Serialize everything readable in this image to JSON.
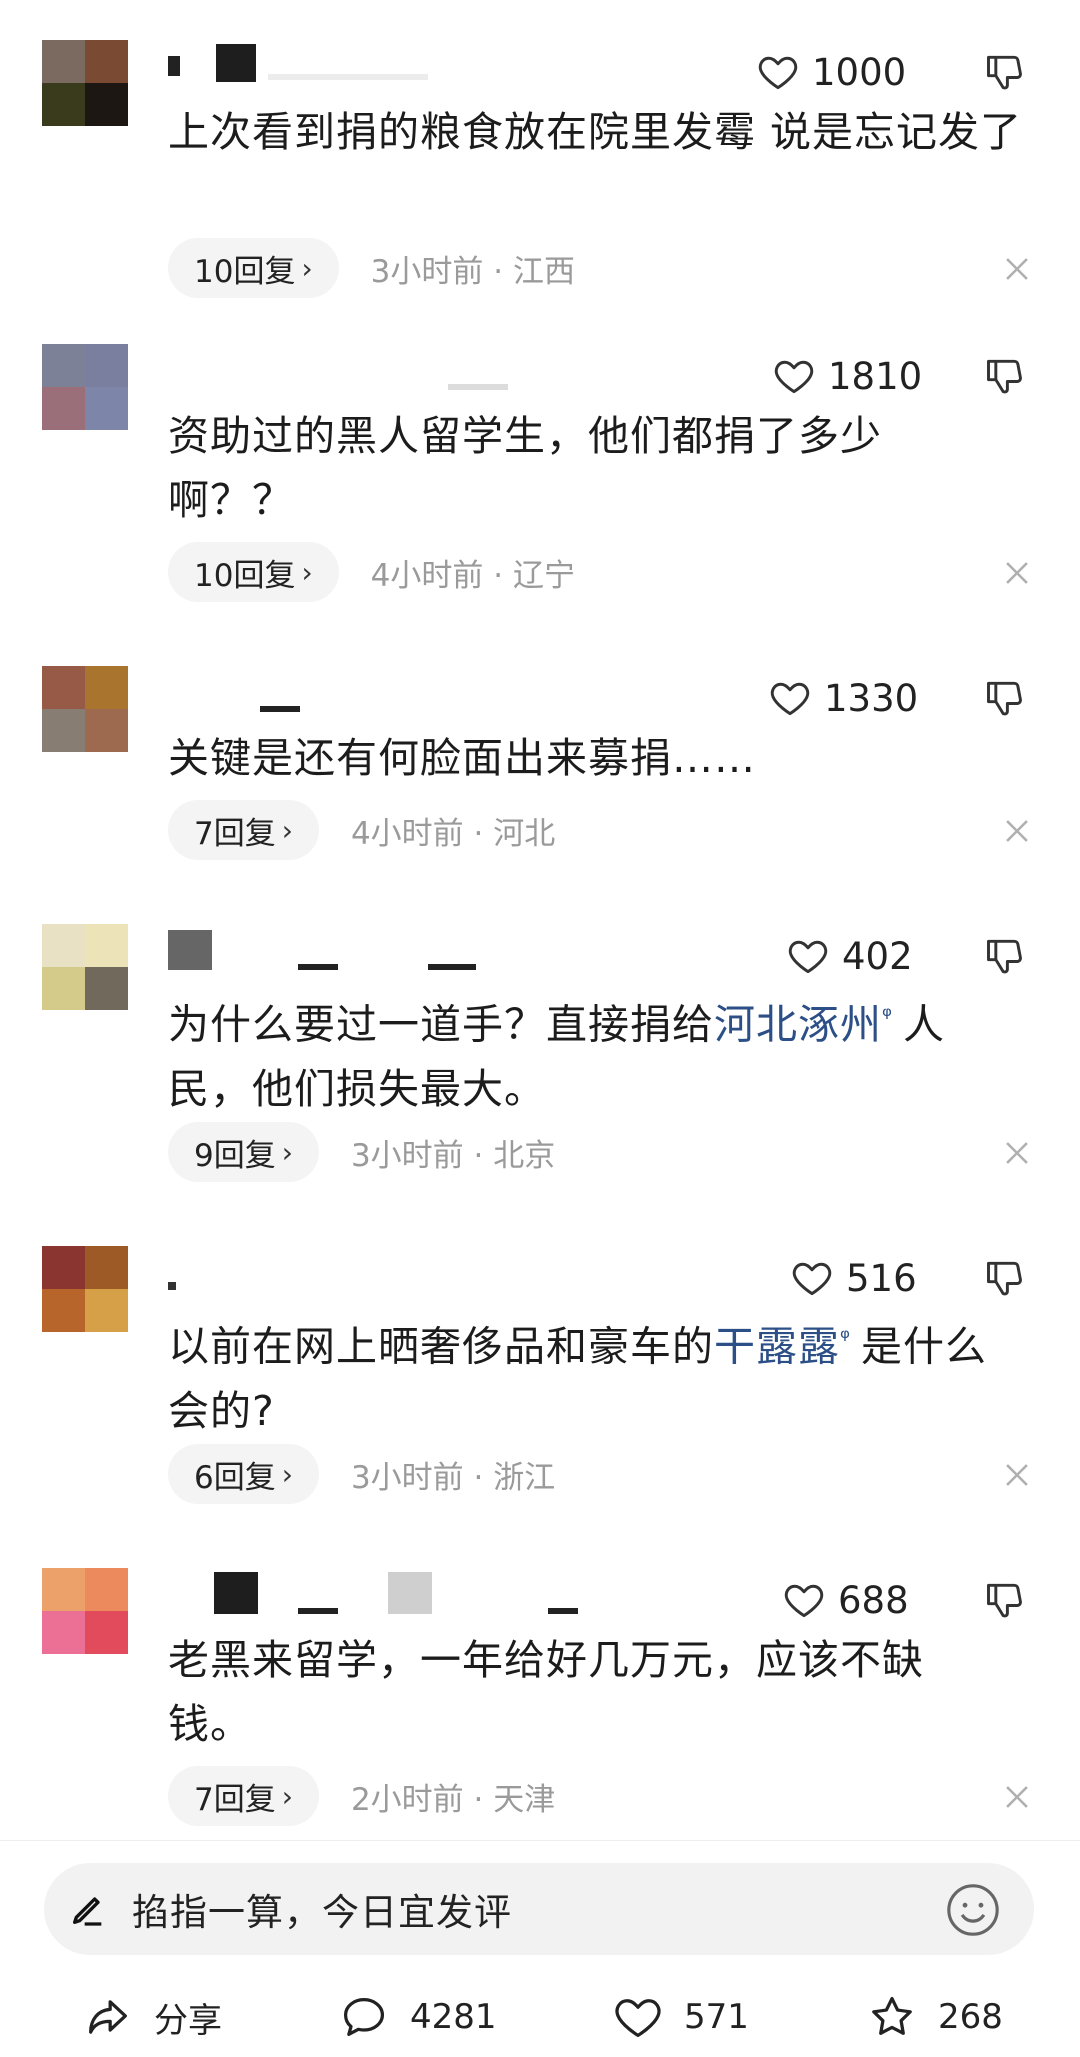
{
  "comments": [
    {
      "text_a": "上次看到捐的粮食放在院里发霉 说是忘记发了",
      "likes": "1000",
      "replies_label": "10回复",
      "time_location": "3小时前 · 江西",
      "avatar_colors": [
        "#7a6a60",
        "#7b4a33",
        "#3a3a1c",
        "#1c1712"
      ]
    },
    {
      "text_a": "资助过的黑人留学生，他们都捐了多少啊？？",
      "likes": "1810",
      "replies_label": "10回复",
      "time_location": "4小时前 · 辽宁",
      "avatar_colors": [
        "#7d8197",
        "#7a7fa0",
        "#9a6f7a",
        "#7d85a8"
      ]
    },
    {
      "text_a": "关键是还有何脸面出来募捐……",
      "likes": "1330",
      "replies_label": "7回复",
      "time_location": "4小时前 · 河北",
      "avatar_colors": [
        "#965a47",
        "#a9742e",
        "#887d73",
        "#9d6a4f"
      ]
    },
    {
      "text_a": "为什么要过一道手？直接捐给",
      "text_kw": "河北涿州",
      "text_b": "人民，他们损失最大。",
      "likes": "402",
      "replies_label": "9回复",
      "time_location": "3小时前 · 北京",
      "avatar_colors": [
        "#e9e1c4",
        "#ede3b8",
        "#d4cb8a",
        "#716a5c"
      ]
    },
    {
      "text_a": "以前在网上晒奢侈品和豪车的",
      "text_kw": "干露露",
      "text_b": "是什么会的?",
      "likes": "516",
      "replies_label": "6回复",
      "time_location": "3小时前 · 浙江",
      "avatar_colors": [
        "#8a3530",
        "#9d5a26",
        "#b8652c",
        "#d5a048"
      ]
    },
    {
      "text_a": "老黑来留学，一年给好几万元，应该不缺钱。",
      "likes": "688",
      "replies_label": "7回复",
      "time_location": "2小时前 · 天津",
      "avatar_colors": [
        "#eda16a",
        "#ec8a5e",
        "#ec6f96",
        "#e14b5c"
      ]
    }
  ],
  "input": {
    "placeholder": "掐指一算，今日宜发评"
  },
  "actions": {
    "share_label": "分享",
    "comments_count": "4281",
    "likes_count": "571",
    "favorites_count": "268"
  },
  "icons": {
    "like": "heart-outline-icon",
    "dislike": "thumbs-down-icon",
    "close": "close-icon",
    "pen": "pen-icon",
    "emoji": "smiley-icon",
    "share": "share-arrow-icon",
    "comment": "speech-bubble-icon",
    "favorite": "star-outline-icon"
  }
}
